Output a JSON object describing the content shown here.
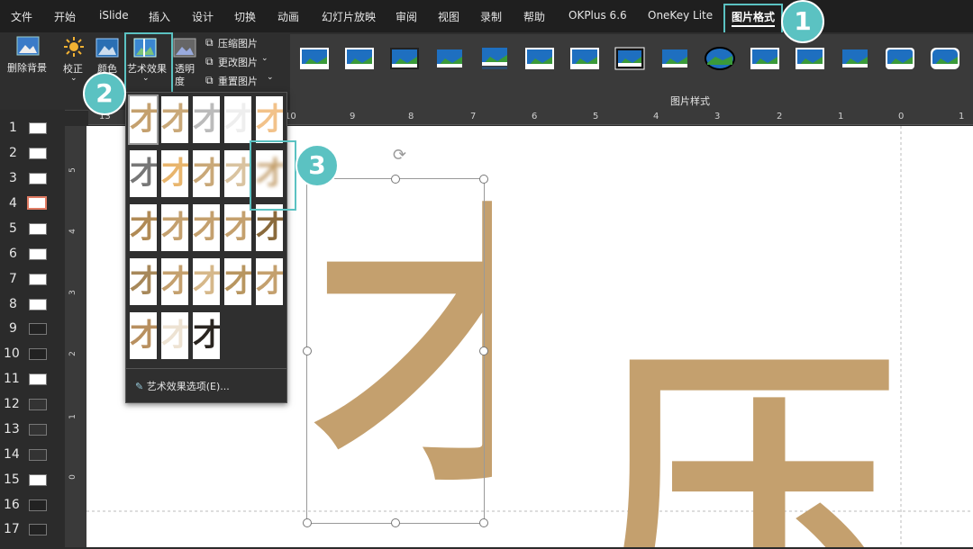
{
  "menu": {
    "items": [
      "文件",
      "开始",
      "iSlide",
      "插入",
      "设计",
      "切换",
      "动画",
      "幻灯片放映",
      "审阅",
      "视图",
      "录制",
      "帮助",
      "OKPlus 6.6",
      "OneKey Lite",
      "图片格式"
    ]
  },
  "ribbon": {
    "remove_bg": "删除背景",
    "corrections": "校正",
    "color": "颜色",
    "artistic_effects": "艺术效果",
    "transparency_1": "透明",
    "transparency_2": "度",
    "compress": "压缩图片",
    "change": "更改图片",
    "reset": "重置图片",
    "styles_group": "图片样式"
  },
  "ruler": {
    "numbers": [
      "13",
      "10",
      "9",
      "8",
      "7",
      "6",
      "5",
      "4",
      "3",
      "2",
      "1",
      "0",
      "1"
    ]
  },
  "vruler": {
    "numbers": [
      "5",
      "4",
      "3",
      "2",
      "1",
      "0"
    ]
  },
  "slides": [
    "1",
    "2",
    "3",
    "4",
    "5",
    "6",
    "7",
    "8",
    "9",
    "10",
    "11",
    "12",
    "13",
    "14",
    "15",
    "16",
    "17"
  ],
  "dropdown": {
    "options_label": "艺术效果选项(E)...",
    "glyph": "才"
  },
  "canvas": {
    "glyph_main": "才",
    "glyph_right": "压",
    "glyph_color": "#c4a06e"
  },
  "callouts": [
    "1",
    "2",
    "3"
  ],
  "colors": {
    "accent": "#5bc2c2",
    "selected_thumb": "#e07b63"
  }
}
